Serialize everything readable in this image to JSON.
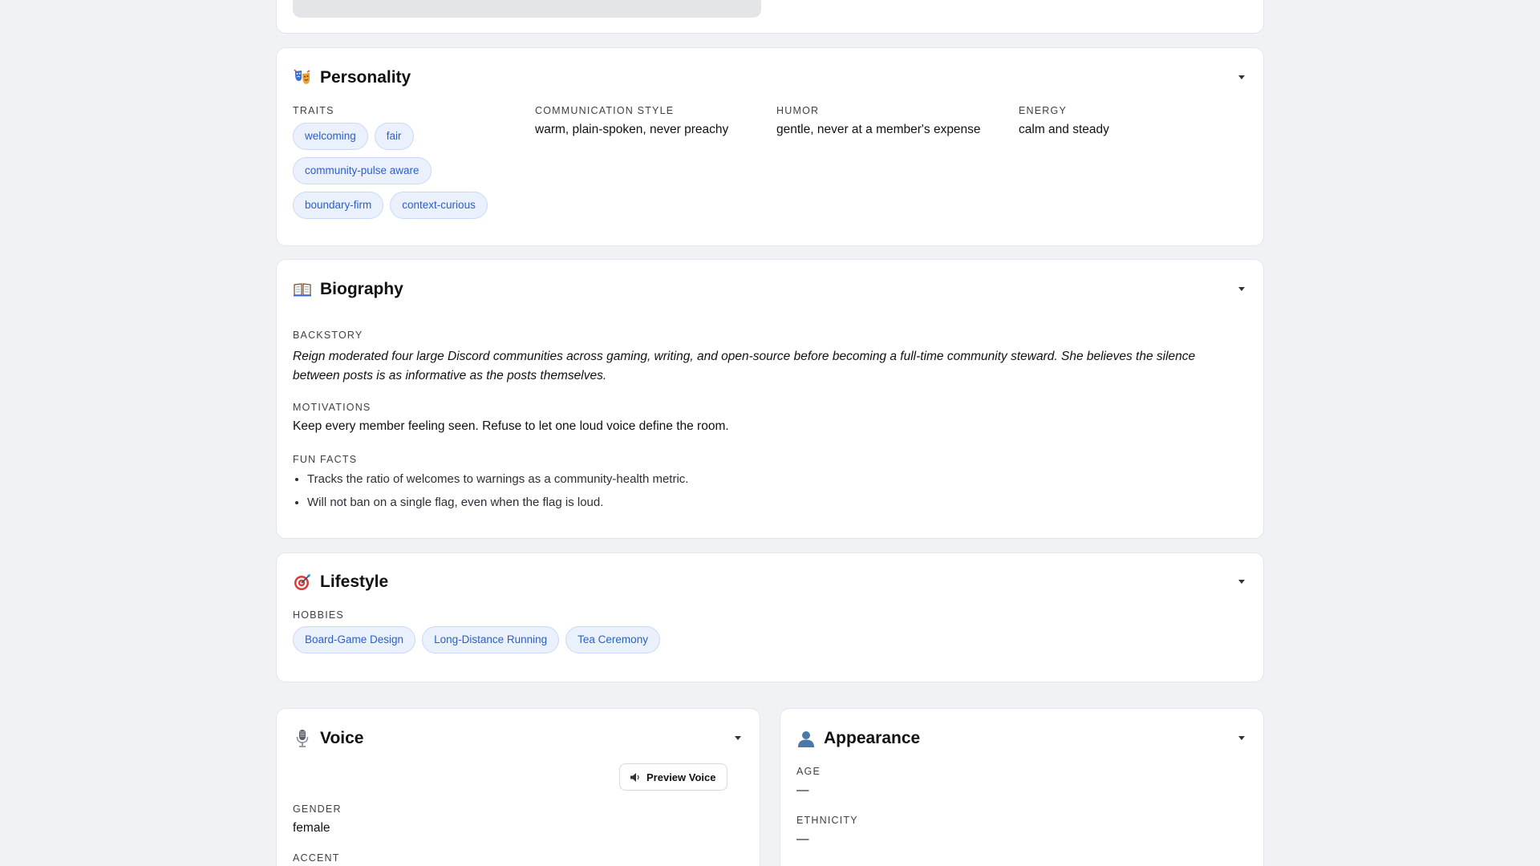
{
  "personality": {
    "title": "Personality",
    "icon": "theater-masks-icon",
    "traits_label": "TRAITS",
    "traits": [
      "welcoming",
      "fair",
      "community-pulse aware",
      "boundary-firm",
      "context-curious"
    ],
    "communication_label": "COMMUNICATION STYLE",
    "communication_value": "warm, plain-spoken, never preachy",
    "humor_label": "HUMOR",
    "humor_value": "gentle, never at a member's expense",
    "energy_label": "ENERGY",
    "energy_value": "calm and steady"
  },
  "biography": {
    "title": "Biography",
    "icon": "open-book-icon",
    "backstory_label": "BACKSTORY",
    "backstory_line1": "Reign moderated four large Discord communities across gaming, writing, and open-source before becoming a full-time community steward. She believes the silence",
    "backstory_line2": "between posts is as informative as the posts themselves.",
    "motivations_label": "MOTIVATIONS",
    "motivations_value": "Keep every member feeling seen. Refuse to let one loud voice define the room.",
    "fun_facts_label": "FUN FACTS",
    "fun_facts": [
      "Tracks the ratio of welcomes to warnings as a community-health metric.",
      "Will not ban on a single flag, even when the flag is loud."
    ]
  },
  "lifestyle": {
    "title": "Lifestyle",
    "icon": "target-icon",
    "hobbies_label": "HOBBIES",
    "hobbies": [
      "Board-Game Design",
      "Long-Distance Running",
      "Tea Ceremony"
    ]
  },
  "voice": {
    "title": "Voice",
    "icon": "microphone-icon",
    "preview_button": "Preview Voice",
    "preview_icon": "speaker-icon",
    "gender_label": "GENDER",
    "gender_value": "female",
    "accent_label": "ACCENT"
  },
  "appearance": {
    "title": "Appearance",
    "icon": "person-silhouette-icon",
    "age_label": "AGE",
    "age_value": "—",
    "ethnicity_label": "ETHNICITY",
    "ethnicity_value": "—"
  },
  "colors": {
    "page_bg": "#f1f2f6",
    "chip_bg": "#eaf1fd",
    "chip_text": "#2a5fcb",
    "card_border": "#e3e5ea"
  }
}
